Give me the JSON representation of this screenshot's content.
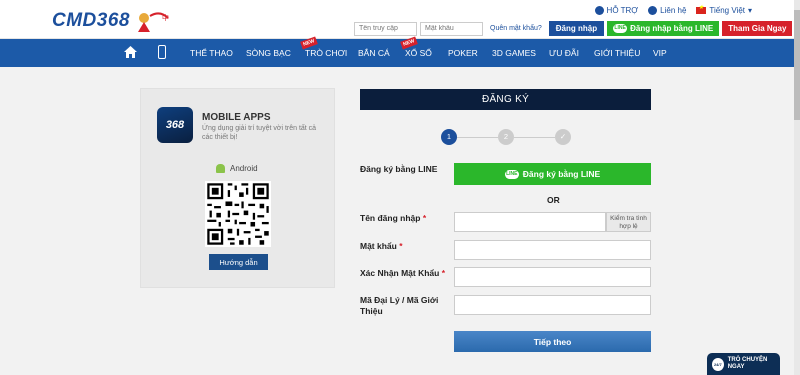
{
  "header": {
    "logo_text": "CMD368",
    "top_links": {
      "support": "HỖ TRỢ",
      "contact": "Liên hệ",
      "language": "Tiếng Việt"
    },
    "login": {
      "username_placeholder": "Tên truy cập",
      "password_placeholder": "Mật khẩu",
      "forgot_label": "Quên mật khẩu?",
      "login_button": "Đăng nhập",
      "line_login_button": "Đăng nhập bằng LINE",
      "join_button": "Tham Gia Ngay"
    }
  },
  "nav": {
    "items": [
      {
        "label": "Thể thao"
      },
      {
        "label": "Sòng bạc"
      },
      {
        "label": "Trò chơi",
        "badge": "NEW"
      },
      {
        "label": "Bắn cá"
      },
      {
        "label": "Xổ số",
        "badge": "NEW"
      },
      {
        "label": "Poker"
      },
      {
        "label": "3D Games"
      },
      {
        "label": "Ưu đãi"
      },
      {
        "label": "Giới thiệu"
      },
      {
        "label": "VIP"
      }
    ]
  },
  "apps": {
    "icon_text": "368",
    "title": "MOBILE APPS",
    "description": "Ứng dụng giải trí tuyệt vời trên tất cả các thiết bị!",
    "platform": "Android",
    "guide_button": "Hướng dẫn"
  },
  "register": {
    "title": "ĐĂNG KÝ",
    "steps": [
      "1",
      "2",
      "✓"
    ],
    "line_label": "Đăng ký bằng LINE",
    "line_button": "Đăng ký bằng LINE",
    "line_logo": "LINE",
    "or_label": "OR",
    "username_label": "Tên đăng nhập",
    "check_button": "Kiểm tra tình hợp lệ",
    "password_label": "Mật khẩu",
    "confirm_label": "Xác Nhận Mật Khẩu",
    "agent_label": "Mã Đại Lý / Mã Giới Thiệu",
    "required_mark": "*",
    "next_button": "Tiếp theo"
  },
  "chat": {
    "icon_text": "24/7",
    "label": "TRÒ CHUYỆN NGAY"
  },
  "colors": {
    "brand_blue": "#1c5aa8",
    "dark_navy": "#0b1e3c",
    "line_green": "#2bb72b",
    "join_red": "#d6212b"
  }
}
